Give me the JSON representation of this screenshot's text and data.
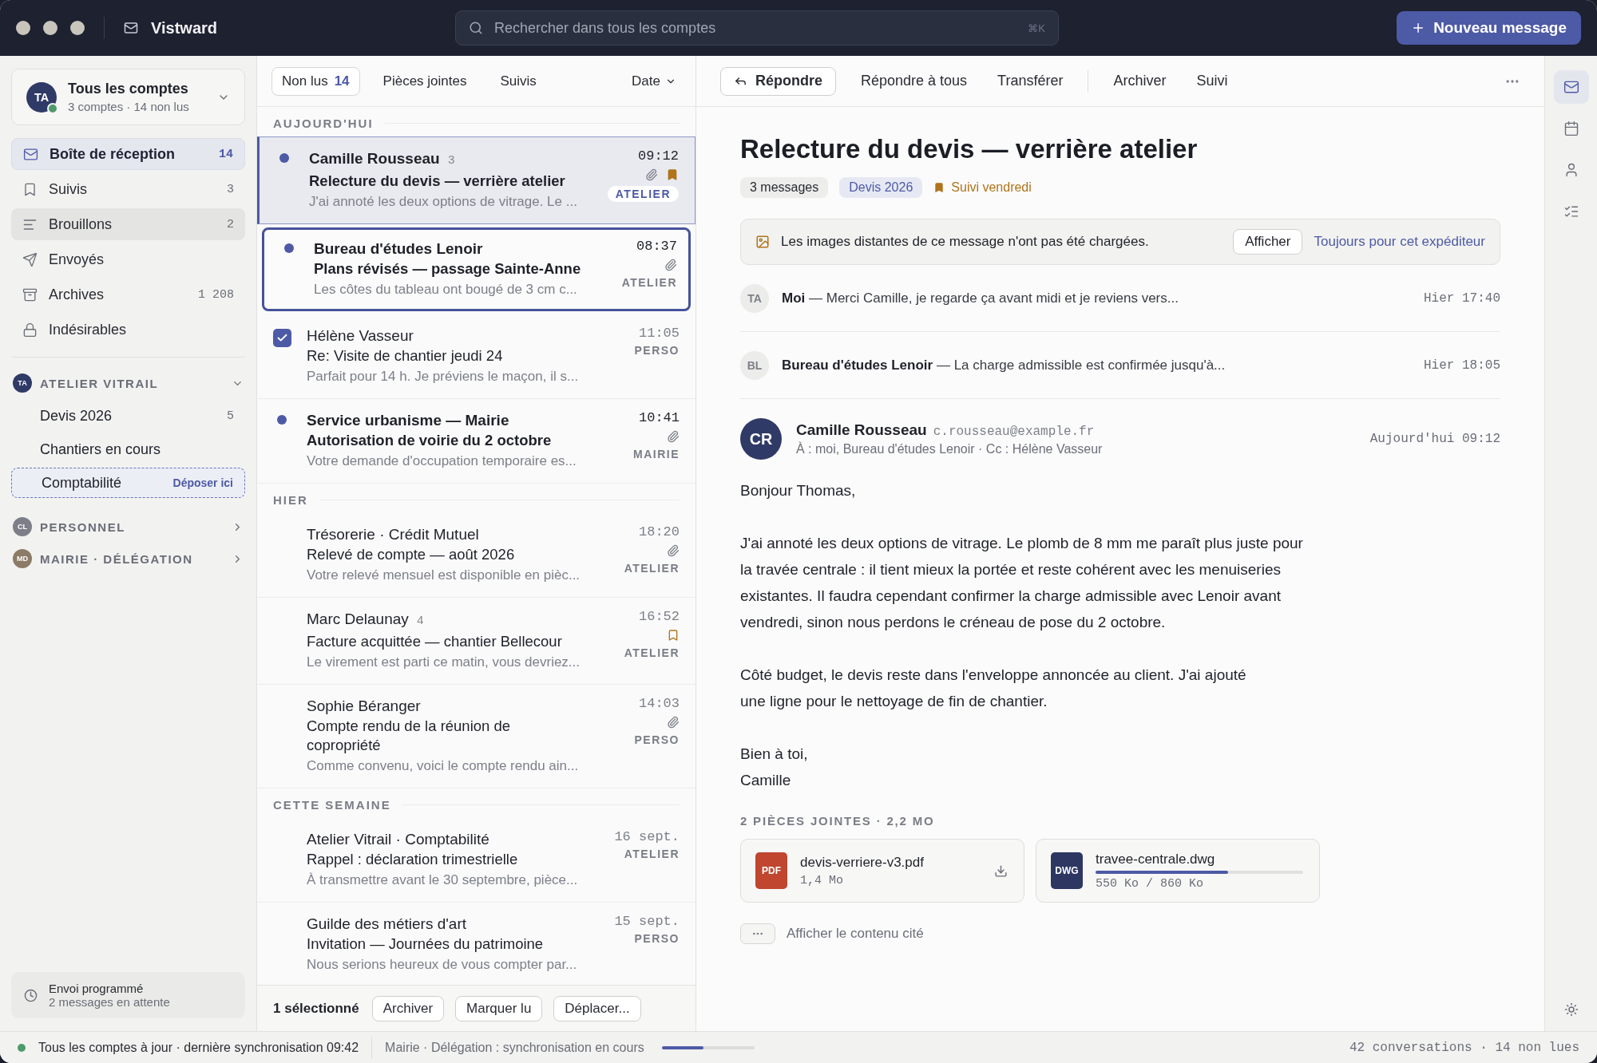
{
  "app": {
    "name": "Vistward"
  },
  "search": {
    "placeholder": "Rechercher dans tous les comptes",
    "shortcut": "⌘K"
  },
  "compose_button": {
    "label": "Nouveau message"
  },
  "account_switcher": {
    "initials": "TA",
    "title": "Tous les comptes",
    "subtitle": "3 comptes · 14 non lus",
    "online": true
  },
  "folders": [
    {
      "kind": "inbox",
      "label": "Boîte de réception",
      "count": "14",
      "selected": true,
      "hovered": false
    },
    {
      "kind": "flagged",
      "label": "Suivis",
      "count": "3",
      "selected": false,
      "hovered": false
    },
    {
      "kind": "drafts",
      "label": "Brouillons",
      "count": "2",
      "selected": false,
      "hovered": true
    },
    {
      "kind": "sent",
      "label": "Envoyés",
      "selected": false,
      "hovered": false
    },
    {
      "kind": "archive",
      "label": "Archives",
      "count": "1 208",
      "selected": false,
      "hovered": false
    },
    {
      "kind": "junk",
      "label": "Indésirables",
      "selected": false,
      "hovered": false
    }
  ],
  "accounts": [
    {
      "initials": "TA",
      "name": "ATELIER VITRAIL",
      "color": "#2f3a66",
      "expanded": true,
      "folders": [
        {
          "label": "Devis 2026",
          "count": "5",
          "drop_target": false
        },
        {
          "label": "Chantiers en cours",
          "drop_target": false
        },
        {
          "label": "Comptabilité",
          "drop_target": true,
          "drop_hint": "Déposer ici"
        }
      ]
    },
    {
      "initials": "CL",
      "name": "PERSONNEL",
      "color": "#7c7f87",
      "expanded": false
    },
    {
      "initials": "MD",
      "name": "MAIRIE · DÉLÉGATION",
      "color": "#8c7b66",
      "expanded": false
    }
  ],
  "scheduled": {
    "title": "Envoi programmé",
    "subtitle": "2 messages en attente"
  },
  "filters": [
    {
      "label": "Non lus",
      "count": "14",
      "selected": true
    },
    {
      "label": "Pièces jointes",
      "selected": false
    },
    {
      "label": "Suivis",
      "selected": false
    }
  ],
  "sort": {
    "label": "Date"
  },
  "groups": [
    {
      "label": "AUJOURD'HUI",
      "messages": [
        {
          "sender": "Camille Rousseau",
          "count": "3",
          "subject": "Relecture du devis — verrière atelier",
          "preview": "J'ai annoté les deux options de vitrage. Le ...",
          "time": "09:12",
          "tag": "ATELIER",
          "unread": true,
          "selected": true,
          "focused": false,
          "checked": false,
          "attachment": true,
          "flagged": true
        },
        {
          "flagged": false,
          "sender": "Bureau d'études Lenoir",
          "subject": "Plans révisés — passage Sainte-Anne",
          "preview": "Les côtes du tableau ont bougé de 3 cm c...",
          "time": "08:37",
          "tag": "ATELIER",
          "unread": true,
          "selected": false,
          "focused": true,
          "checked": false,
          "attachment": true
        },
        {
          "flagged": false,
          "sender": "Hélène Vasseur",
          "subject": "Re: Visite de chantier jeudi 24",
          "preview": "Parfait pour 14 h. Je préviens le maçon, il s...",
          "time": "11:05",
          "tag": "PERSO",
          "unread": false,
          "selected": false,
          "focused": false,
          "checked": true,
          "attachment": false
        },
        {
          "flagged": false,
          "sender": "Service urbanisme — Mairie",
          "subject": "Autorisation de voirie du 2 octobre",
          "preview": "Votre demande d'occupation temporaire es...",
          "time": "10:41",
          "tag": "MAIRIE",
          "unread": true,
          "selected": false,
          "focused": false,
          "checked": false,
          "attachment": true
        }
      ]
    },
    {
      "label": "HIER",
      "messages": [
        {
          "flagged": false,
          "sender": "Trésorerie · Crédit Mutuel",
          "subject": "Relevé de compte — août 2026",
          "preview": "Votre relevé mensuel est disponible en pièc...",
          "time": "18:20",
          "tag": "ATELIER",
          "unread": false,
          "selected": false,
          "focused": false,
          "checked": false,
          "attachment": true
        },
        {
          "sender": "Marc Delaunay",
          "count": "4",
          "subject": "Facture acquittée — chantier Bellecour",
          "preview": "Le virement est parti ce matin, vous devriez...",
          "time": "16:52",
          "tag": "ATELIER",
          "unread": false,
          "selected": false,
          "focused": false,
          "checked": false,
          "attachment": false,
          "flagged": true
        },
        {
          "flagged": false,
          "sender": "Sophie Béranger",
          "subject": "Compte rendu de la réunion de\ncopropriété",
          "preview": "Comme convenu, voici le compte rendu ain...",
          "time": "14:03",
          "tag": "PERSO",
          "unread": false,
          "selected": false,
          "focused": false,
          "checked": false,
          "attachment": true
        }
      ]
    },
    {
      "label": "CETTE SEMAINE",
      "messages": [
        {
          "flagged": false,
          "sender": "Atelier Vitrail · Comptabilité",
          "subject": "Rappel : déclaration trimestrielle",
          "preview": "À transmettre avant le 30 septembre, pièce...",
          "time": "16 sept.",
          "tag": "ATELIER",
          "unread": false,
          "selected": false,
          "focused": false,
          "checked": false,
          "attachment": false
        },
        {
          "flagged": false,
          "sender": "Guilde des métiers d'art",
          "subject": "Invitation — Journées du patrimoine",
          "preview": "Nous serions heureux de vous compter par...",
          "time": "15 sept.",
          "tag": "PERSO",
          "unread": false,
          "selected": false,
          "focused": false,
          "checked": false,
          "attachment": false
        }
      ]
    }
  ],
  "selection_bar": {
    "label": "1 sélectionné",
    "actions": [
      "Archiver",
      "Marquer lu",
      "Déplacer..."
    ]
  },
  "toolbar": {
    "groups": [
      [
        {
          "label": "Répondre",
          "primary": true
        },
        {
          "label": "Répondre à tous",
          "primary": false
        },
        {
          "label": "Transférer",
          "primary": false
        }
      ],
      [
        {
          "label": "Archiver",
          "primary": false
        },
        {
          "label": "Suivi",
          "primary": false
        }
      ]
    ]
  },
  "conversation": {
    "title": "Relecture du devis — verrière atelier",
    "chips": [
      {
        "kind": "count",
        "label": "3 messages"
      },
      {
        "kind": "folder",
        "label": "Devis 2026"
      },
      {
        "kind": "followup",
        "label": "Suivi vendredi"
      }
    ],
    "banner": {
      "text": "Les images distantes de ce message n'ont pas été chargées.",
      "button": "Afficher",
      "link": "Toujours pour cet expéditeur"
    },
    "collapsed": [
      {
        "initials": "TA",
        "sender": "Moi",
        "snippet": " — Merci Camille, je regarde ça avant midi et je reviens vers...",
        "time": "Hier 17:40"
      },
      {
        "initials": "BL",
        "sender": "Bureau d'études Lenoir",
        "snippet": " — La charge admissible est confirmée jusqu'à...",
        "time": "Hier 18:05"
      }
    ],
    "open": {
      "initials": "CR",
      "sender": "Camille Rousseau",
      "email": "c.rousseau@example.fr",
      "recipients": "À : moi, Bureau d'études Lenoir · Cc : Hélène Vasseur",
      "time": "Aujourd'hui 09:12",
      "paragraphs": [
        "Bonjour Thomas,",
        "J'ai annoté les deux options de vitrage. Le plomb de 8 mm me paraît plus juste pour\nla travée centrale : il tient mieux la portée et reste cohérent avec les menuiseries\nexistantes. Il faudra cependant confirmer la charge admissible avec Lenoir avant\nvendredi, sinon nous perdons le créneau de pose du 2 octobre.",
        "Côté budget, le devis reste dans l'enveloppe annoncée au client. J'ai ajouté\nune ligne pour le nettoyage de fin de chantier.",
        "Bien à toi,\nCamille"
      ]
    },
    "attachments": {
      "header": "2 PIÈCES JOINTES · 2,2 MO",
      "files": [
        {
          "kind": "done",
          "type": "PDF",
          "color": "#c0462f",
          "name": "devis-verriere-v3.pdf",
          "size": "1,4 Mo"
        },
        {
          "kind": "downloading",
          "type": "DWG",
          "color": "#2d3762",
          "name": "travee-centrale.dwg",
          "size": "550 Ko / 860 Ko",
          "level": 0.64
        }
      ]
    },
    "quoted": {
      "label": "Afficher le contenu cité"
    }
  },
  "rail": [
    {
      "kind": "mail",
      "selected": true
    },
    {
      "kind": "calendar",
      "selected": false
    },
    {
      "kind": "contacts",
      "selected": false
    },
    {
      "kind": "tasks",
      "selected": false
    }
  ],
  "status": {
    "sync_ok": true,
    "sync_text": "Tous les comptes à jour · dernière synchronisation 09:42",
    "progress_text": "Mairie · Délégation : synchronisation en cours",
    "level": 0.45,
    "summary": "42 conversations · 14 non lues"
  }
}
